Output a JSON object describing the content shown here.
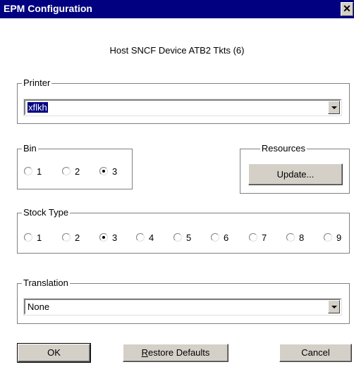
{
  "window": {
    "title": "EPM Configuration",
    "close_glyph": "✕"
  },
  "host_line": "Host SNCF  Device ATB2 Tkts (6)",
  "printer": {
    "legend": "Printer",
    "value": "xflkh"
  },
  "bin": {
    "legend": "Bin",
    "options": [
      "1",
      "2",
      "3"
    ],
    "selected": "3"
  },
  "resources": {
    "legend": "Resources",
    "update_label": "Update..."
  },
  "stock_type": {
    "legend": "Stock Type",
    "options": [
      "1",
      "2",
      "3",
      "4",
      "5",
      "6",
      "7",
      "8",
      "9"
    ],
    "selected": "3"
  },
  "translation": {
    "legend": "Translation",
    "value": "None"
  },
  "buttons": {
    "ok_label": "OK",
    "restore_first": "R",
    "restore_rest": "estore Defaults",
    "cancel_label": "Cancel"
  }
}
